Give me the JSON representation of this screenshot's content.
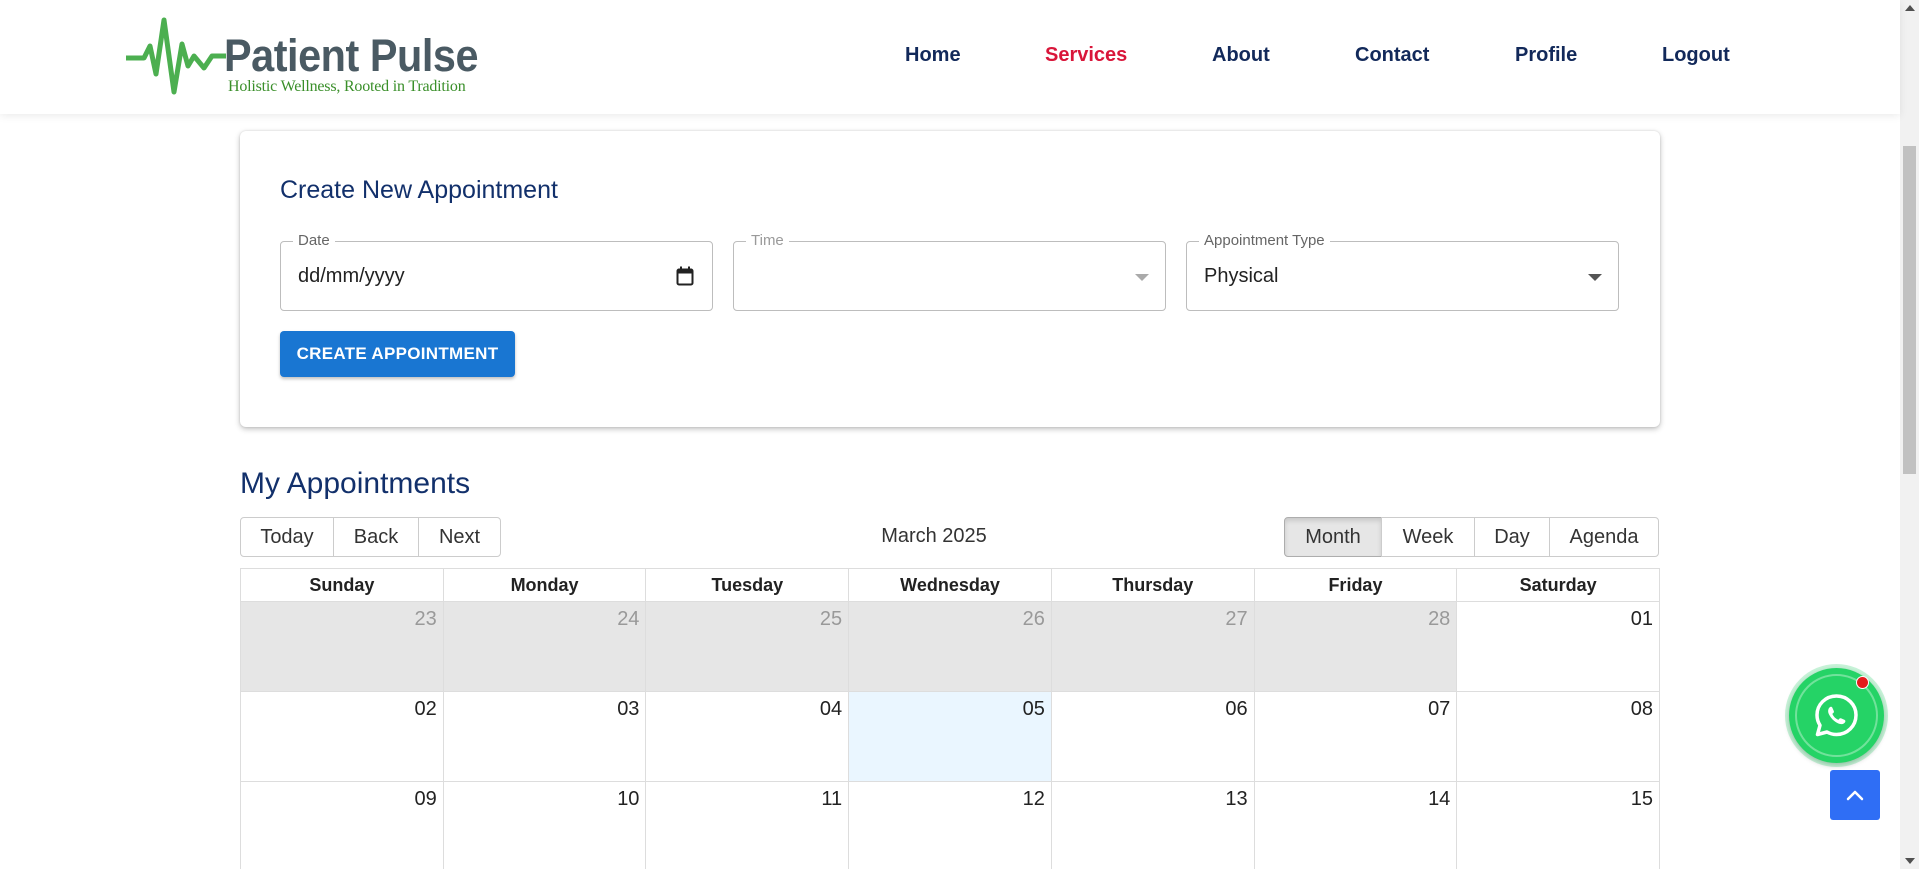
{
  "header": {
    "logo": {
      "title": "Patient Pulse",
      "tagline": "Holistic Wellness, Rooted in Tradition"
    },
    "nav": [
      {
        "label": "Home",
        "active": false
      },
      {
        "label": "Services",
        "active": true
      },
      {
        "label": "About",
        "active": false
      },
      {
        "label": "Contact",
        "active": false
      },
      {
        "label": "Profile",
        "active": false
      },
      {
        "label": "Logout",
        "active": false
      }
    ],
    "active_color": "#d9163a",
    "nav_color": "#12295a"
  },
  "create_form": {
    "title": "Create New Appointment",
    "date": {
      "label": "Date",
      "value": "dd/mm/yyyy"
    },
    "time": {
      "label": "Time",
      "value": ""
    },
    "type": {
      "label": "Appointment Type",
      "value": "Physical"
    },
    "submit_label": "CREATE APPOINTMENT"
  },
  "appointments": {
    "title": "My Appointments",
    "toolbar": {
      "nav_buttons": [
        "Today",
        "Back",
        "Next"
      ],
      "label": "March 2025",
      "views": [
        "Month",
        "Week",
        "Day",
        "Agenda"
      ],
      "active_view": "Month"
    },
    "weekdays": [
      "Sunday",
      "Monday",
      "Tuesday",
      "Wednesday",
      "Thursday",
      "Friday",
      "Saturday"
    ],
    "weeks": [
      [
        {
          "day": "23",
          "off": true
        },
        {
          "day": "24",
          "off": true
        },
        {
          "day": "25",
          "off": true
        },
        {
          "day": "26",
          "off": true
        },
        {
          "day": "27",
          "off": true
        },
        {
          "day": "28",
          "off": true
        },
        {
          "day": "01",
          "off": false
        }
      ],
      [
        {
          "day": "02",
          "off": false
        },
        {
          "day": "03",
          "off": false
        },
        {
          "day": "04",
          "off": false
        },
        {
          "day": "05",
          "off": false,
          "today": true
        },
        {
          "day": "06",
          "off": false
        },
        {
          "day": "07",
          "off": false
        },
        {
          "day": "08",
          "off": false
        }
      ],
      [
        {
          "day": "09",
          "off": false
        },
        {
          "day": "10",
          "off": false
        },
        {
          "day": "11",
          "off": false
        },
        {
          "day": "12",
          "off": false
        },
        {
          "day": "13",
          "off": false
        },
        {
          "day": "14",
          "off": false
        },
        {
          "day": "15",
          "off": false
        }
      ]
    ]
  },
  "floating": {
    "whatsapp_icon": "whatsapp-icon",
    "whatsapp_color": "#25d366",
    "scroll_top_icon": "chevron-up-icon",
    "scroll_top_color": "#2f6ef5"
  }
}
